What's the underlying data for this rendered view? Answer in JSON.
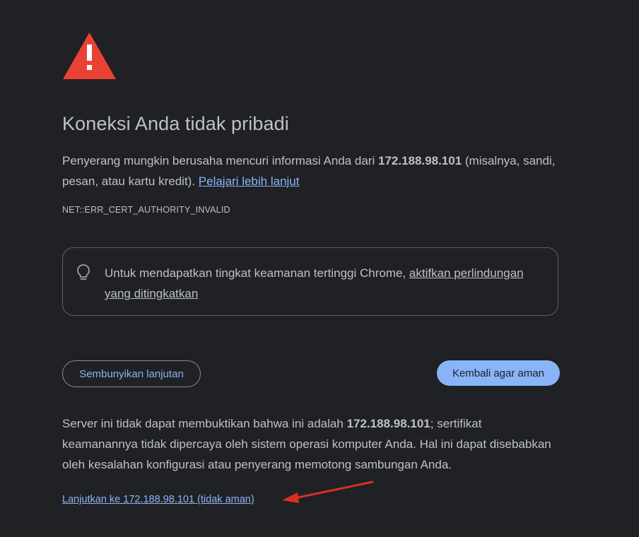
{
  "page": {
    "title": "Koneksi Anda tidak pribadi",
    "intro_before": "Penyerang mungkin berusaha mencuri informasi Anda dari ",
    "intro_host": "172.188.98.101",
    "intro_after": " (misalnya, sandi, pesan, atau kartu kredit). ",
    "learn_more": "Pelajari lebih lanjut",
    "error_code": "NET::ERR_CERT_AUTHORITY_INVALID"
  },
  "enhanced": {
    "text": "Untuk mendapatkan tingkat keamanan tertinggi Chrome, ",
    "link": "aktifkan perlindungan yang ditingkatkan"
  },
  "buttons": {
    "hide_advanced": "Sembunyikan lanjutan",
    "back_to_safety": "Kembali agar aman"
  },
  "details": {
    "before": "Server ini tidak dapat membuktikan bahwa ini adalah ",
    "host": "172.188.98.101",
    "after": "; sertifikat keamanannya tidak dipercaya oleh sistem operasi komputer Anda. Hal ini dapat disebabkan oleh kesalahan konfigurasi atau penyerang memotong sambungan Anda."
  },
  "proceed_link": "Lanjutkan ke 172.188.98.101 (tidak aman)",
  "colors": {
    "background": "#202124",
    "text": "#bdc1c6",
    "accent": "#8ab4f8",
    "warning": "#e94235",
    "annotation_arrow": "#d93025"
  },
  "icons": {
    "warning": "warning-triangle-icon",
    "bulb": "lightbulb-icon",
    "annotation": "red-arrow-annotation"
  }
}
